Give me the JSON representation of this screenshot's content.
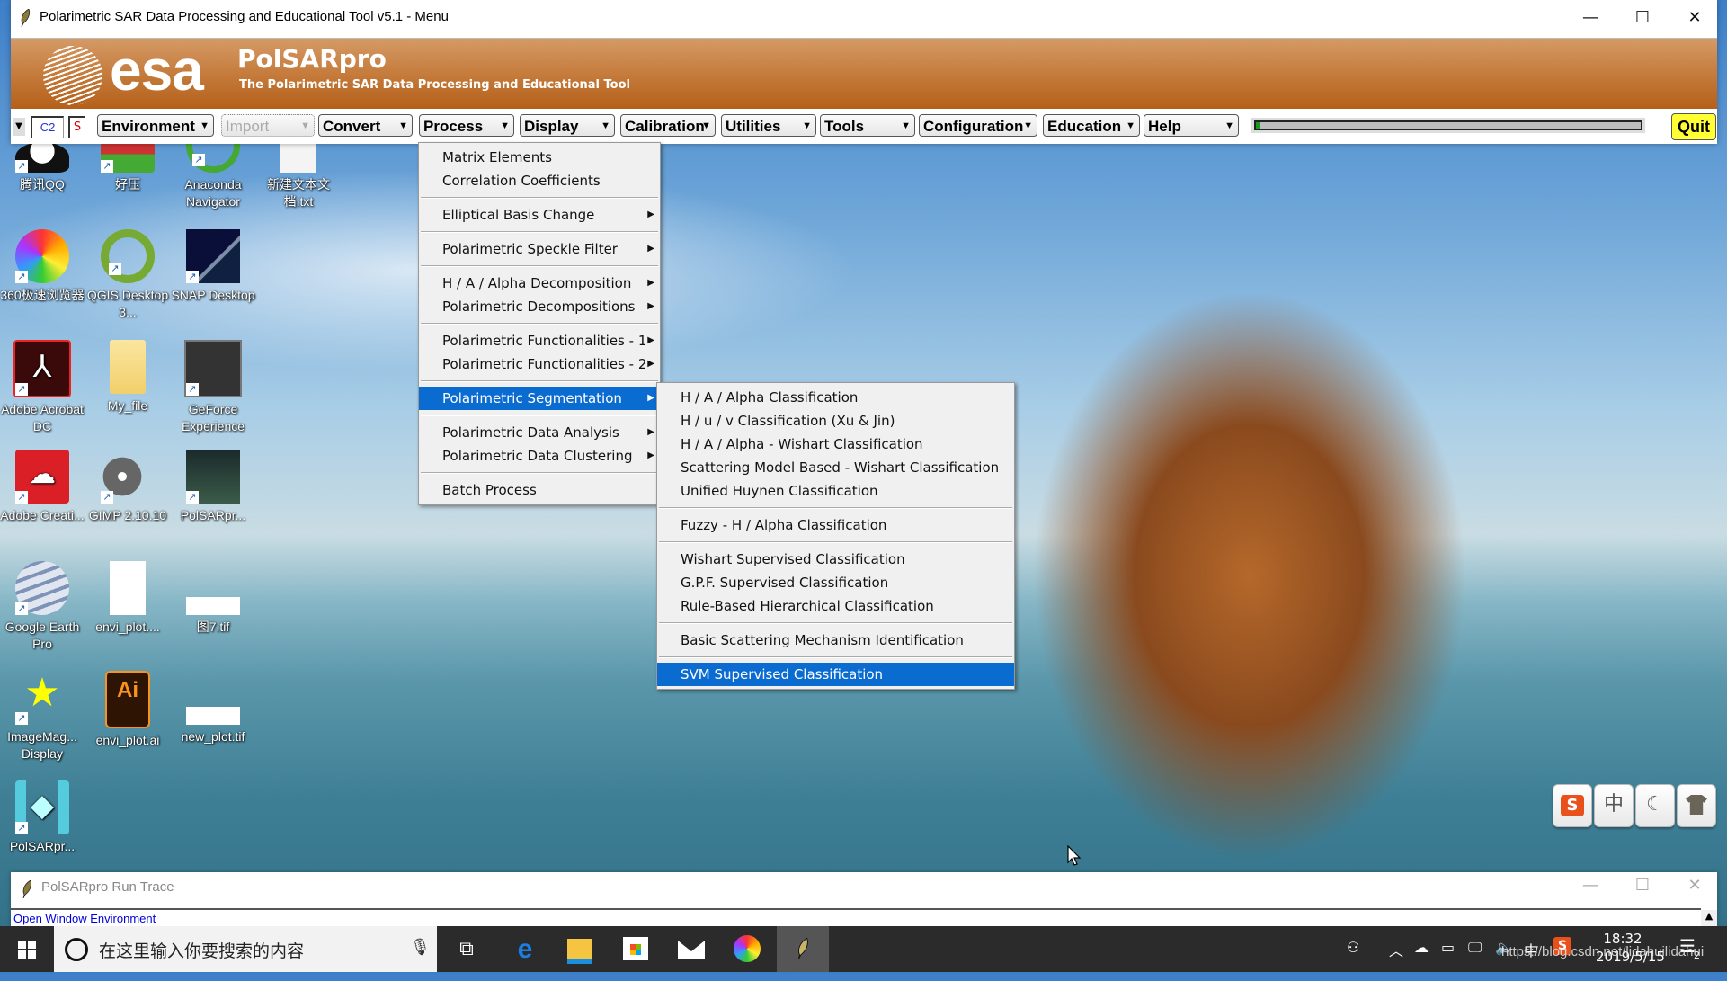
{
  "main_window": {
    "title": "Polarimetric SAR Data Processing and Educational Tool v5.1 - Menu",
    "controls": {
      "minimize": "—",
      "maximize": "☐",
      "close": "✕"
    },
    "banner": {
      "logo_text": "esa",
      "product_name": "PolSARpro",
      "product_subtitle": "The Polarimetric SAR Data Processing and Educational Tool"
    },
    "toolbar": {
      "matrix_type": "C2",
      "mode_flag": "S",
      "menus": [
        {
          "label": "Environment",
          "enabled": true
        },
        {
          "label": "Import",
          "enabled": false
        },
        {
          "label": "Convert",
          "enabled": true
        },
        {
          "label": "Process",
          "enabled": true,
          "open": true
        },
        {
          "label": "Display",
          "enabled": true
        },
        {
          "label": "Calibration",
          "enabled": true
        },
        {
          "label": "Utilities",
          "enabled": true
        },
        {
          "label": "Tools",
          "enabled": true
        },
        {
          "label": "Configuration",
          "enabled": true
        },
        {
          "label": "Education",
          "enabled": true
        },
        {
          "label": "Help",
          "enabled": true
        }
      ],
      "progress_percent": 1,
      "quit_label": "Quit",
      "dropdown_arrow": "▼"
    }
  },
  "process_menu": {
    "groups": [
      [
        {
          "label": "Matrix Elements",
          "submenu": false
        },
        {
          "label": "Correlation Coefficients",
          "submenu": false
        }
      ],
      [
        {
          "label": "Elliptical Basis Change",
          "submenu": true
        }
      ],
      [
        {
          "label": "Polarimetric Speckle Filter",
          "submenu": true
        }
      ],
      [
        {
          "label": "H / A / Alpha Decomposition",
          "submenu": true
        },
        {
          "label": "Polarimetric Decompositions",
          "submenu": true
        }
      ],
      [
        {
          "label": "Polarimetric Functionalities - 1",
          "submenu": true
        },
        {
          "label": "Polarimetric Functionalities - 2",
          "submenu": true
        }
      ],
      [
        {
          "label": "Polarimetric Segmentation",
          "submenu": true,
          "highlighted": true
        }
      ],
      [
        {
          "label": "Polarimetric Data Analysis",
          "submenu": true
        },
        {
          "label": "Polarimetric Data Clustering",
          "submenu": true
        }
      ],
      [
        {
          "label": "Batch Process",
          "submenu": false
        }
      ]
    ],
    "submenu_arrow": "▶"
  },
  "segmentation_submenu": {
    "groups": [
      [
        {
          "label": "H / A / Alpha Classification"
        },
        {
          "label": "H / u / v Classification (Xu & Jin)"
        },
        {
          "label": "H / A / Alpha - Wishart Classification"
        },
        {
          "label": "Scattering Model Based - Wishart Classification"
        },
        {
          "label": "Unified Huynen Classification"
        }
      ],
      [
        {
          "label": "Fuzzy - H / Alpha Classification"
        }
      ],
      [
        {
          "label": "Wishart Supervised Classification"
        },
        {
          "label": "G.P.F. Supervised Classification"
        },
        {
          "label": "Rule-Based Hierarchical Classification"
        }
      ],
      [
        {
          "label": "Basic Scattering Mechanism Identification"
        }
      ],
      [
        {
          "label": "SVM Supervised Classification",
          "highlighted": true
        }
      ]
    ]
  },
  "desktop_icons": [
    {
      "label": "腾讯QQ",
      "icon": "qq-icon"
    },
    {
      "label": "好压",
      "icon": "haozip-icon"
    },
    {
      "label": "Anaconda Navigator",
      "icon": "anaconda-icon"
    },
    {
      "label": "新建文本文档.txt",
      "icon": "text-file-icon"
    },
    {
      "label": "360极速浏览器",
      "icon": "browser-360-icon"
    },
    {
      "label": "QGIS Desktop 3...",
      "icon": "qgis-icon"
    },
    {
      "label": "SNAP Desktop",
      "icon": "snap-icon"
    },
    {
      "label": "Adobe Acrobat DC",
      "icon": "acrobat-icon"
    },
    {
      "label": "My_file",
      "icon": "folder-icon"
    },
    {
      "label": "GeForce Experience",
      "icon": "geforce-icon"
    },
    {
      "label": "Adobe Creati...",
      "icon": "creative-cloud-icon"
    },
    {
      "label": "GIMP 2.10.10",
      "icon": "gimp-icon"
    },
    {
      "label": "PolSARpr...",
      "icon": "polsarpro-icon"
    },
    {
      "label": "Google Earth Pro",
      "icon": "google-earth-icon"
    },
    {
      "label": "envi_plot....",
      "icon": "blank-file-icon"
    },
    {
      "label": "图7.tif",
      "icon": "tif-image-icon"
    },
    {
      "label": "ImageMag... Display",
      "icon": "imagemagick-icon"
    },
    {
      "label": "envi_plot.ai",
      "icon": "illustrator-icon"
    },
    {
      "label": "new_plot.tif",
      "icon": "tif-image-icon"
    },
    {
      "label": "PolSARpr...",
      "icon": "polsarpro-alt-icon"
    }
  ],
  "run_trace": {
    "title": "PolSARpro Run Trace",
    "message": "Open Window Environment"
  },
  "ime_toolbar": {
    "buttons": [
      "S",
      "中",
      "☾",
      "shirt"
    ]
  },
  "taskbar": {
    "search_placeholder": "在这里输入你要搜索的内容",
    "pinned": [
      "task-view",
      "edge",
      "file-explorer",
      "store",
      "mail",
      "360-browser",
      "polsarpro"
    ],
    "tray": {
      "ime_label": "中",
      "time": "18:32",
      "date": "2019/5/15",
      "notifications": "2"
    },
    "watermark": "https://blog.csdn.net/lidahuilidahui"
  }
}
